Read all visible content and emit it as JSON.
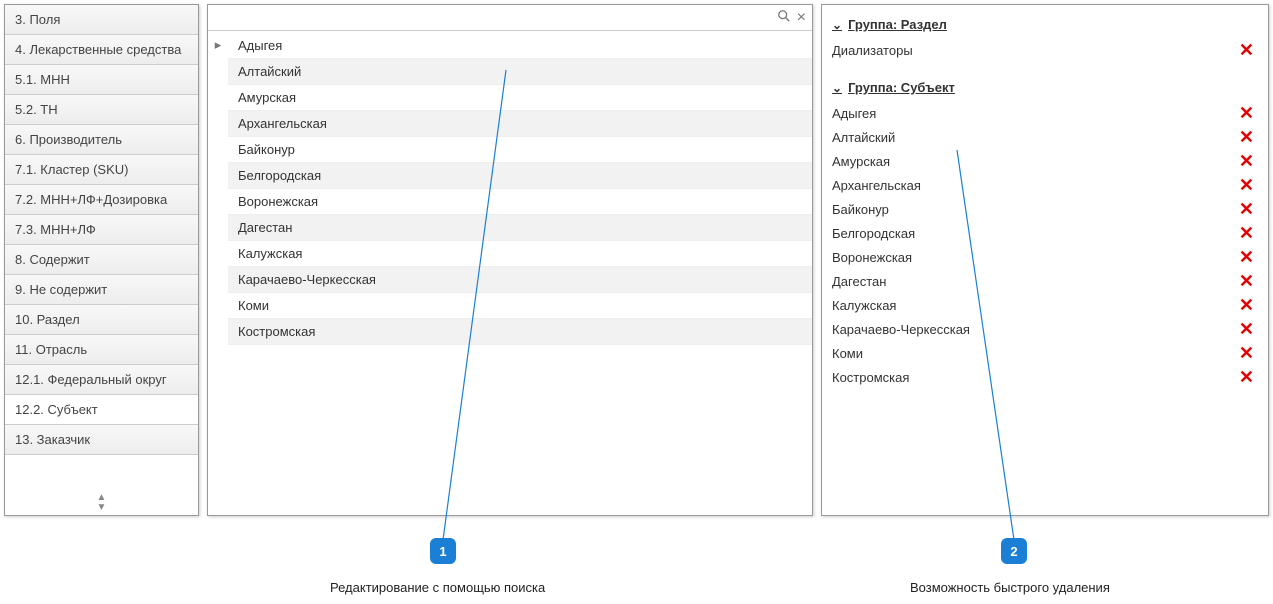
{
  "sidebar": {
    "items": [
      {
        "label": "3. Поля",
        "active": false
      },
      {
        "label": "4. Лекарственные средства",
        "active": false
      },
      {
        "label": "5.1. МНН",
        "active": false
      },
      {
        "label": "5.2. ТН",
        "active": false
      },
      {
        "label": "6. Производитель",
        "active": false
      },
      {
        "label": "7.1. Кластер (SKU)",
        "active": false
      },
      {
        "label": "7.2. МНН+ЛФ+Дозировка",
        "active": false
      },
      {
        "label": "7.3. МНН+ЛФ",
        "active": false
      },
      {
        "label": "8. Содержит",
        "active": false
      },
      {
        "label": "9. Не содержит",
        "active": false
      },
      {
        "label": "10. Раздел",
        "active": false
      },
      {
        "label": "11. Отрасль",
        "active": false
      },
      {
        "label": "12.1. Федеральный округ",
        "active": false
      },
      {
        "label": "12.2. Субъект",
        "active": true
      },
      {
        "label": "13. Заказчик",
        "active": false
      }
    ]
  },
  "regions": [
    "Адыгея",
    "Алтайский",
    "Амурская",
    "Архангельская",
    "Байконур",
    "Белгородская",
    "Воронежская",
    "Дагестан",
    "Калужская",
    "Карачаево-Черкесская",
    "Коми",
    "Костромская"
  ],
  "selection": {
    "groups": [
      {
        "title": "Группа: Раздел",
        "items": [
          "Диализаторы"
        ]
      },
      {
        "title": "Группа: Субъект",
        "items": [
          "Адыгея",
          "Алтайский",
          "Амурская",
          "Архангельская",
          "Байконур",
          "Белгородская",
          "Воронежская",
          "Дагестан",
          "Калужская",
          "Карачаево-Черкесская",
          "Коми",
          "Костромская"
        ]
      }
    ]
  },
  "callouts": {
    "c1": {
      "num": "1",
      "label": "Редактирование с помощью поиска"
    },
    "c2": {
      "num": "2",
      "label": "Возможность быстрого удаления"
    }
  }
}
